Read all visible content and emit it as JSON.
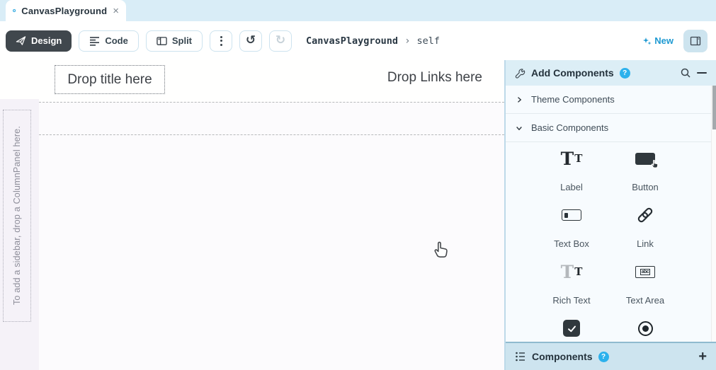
{
  "tab_bar": {
    "title": "CanvasPlayground",
    "close": "×",
    "file_icon": "blue-circle-form-icon"
  },
  "toolbar": {
    "design": "Design",
    "code": "Code",
    "split": "Split",
    "undo_icon": "↺",
    "redo_icon": "↻",
    "breadcrumb": {
      "app": "CanvasPlayground",
      "separator": "›",
      "page": "self"
    },
    "new_label": "New"
  },
  "canvas": {
    "drop_title": "Drop title here",
    "drop_links": "Drop Links here",
    "sidebar_hint": "To add a sidebar, drop a ColumnPanel here."
  },
  "panel": {
    "title": "Add Components",
    "help_badge": "?",
    "sections": [
      {
        "label": "Theme Components",
        "state": "collapsed"
      },
      {
        "label": "Basic Components",
        "state": "expanded"
      }
    ],
    "components": [
      {
        "label": "Label",
        "icon": "serif-Tt-icon"
      },
      {
        "label": "Button",
        "icon": "button-with-hand-cursor-icon"
      },
      {
        "label": "Text Box",
        "icon": "textbox-outline-icon"
      },
      {
        "label": "Link",
        "icon": "chain-link-icon"
      },
      {
        "label": "Rich Text",
        "icon": "serif-Tt-light-icon"
      },
      {
        "label": "Text Area",
        "icon": "textarea-abc-icon"
      },
      {
        "label": "",
        "icon": "checkbox-checked-icon"
      },
      {
        "label": "",
        "icon": "radio-selected-icon"
      }
    ],
    "icon_glyphs": {
      "label_T_big": "T",
      "label_T_small": "T",
      "textarea_text": "abc"
    },
    "footer": {
      "label": "Components",
      "help_badge": "?",
      "add": "+"
    }
  },
  "colors": {
    "accent_blue": "#1f9ad2",
    "badge_blue": "#2cb1ec",
    "dark_button": "#40474d",
    "tab_bar_bg": "#d9edf7",
    "panel_header_bg": "#dceef6",
    "footer_bar_bg": "#cde4ef"
  }
}
